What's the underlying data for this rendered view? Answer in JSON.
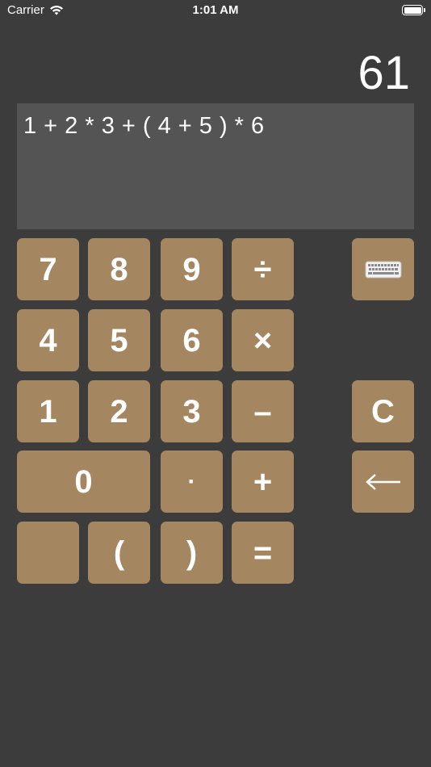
{
  "status_bar": {
    "carrier": "Carrier",
    "time": "1:01 AM"
  },
  "display": {
    "result": "61",
    "expression": "1 + 2 * 3 + ( 4 + 5 ) * 6"
  },
  "keys": {
    "seven": "7",
    "eight": "8",
    "nine": "9",
    "divide": "÷",
    "four": "4",
    "five": "5",
    "six": "6",
    "multiply": "×",
    "one": "1",
    "two": "2",
    "three": "3",
    "minus": "–",
    "clear": "C",
    "zero": "0",
    "dot": "·",
    "plus": "+",
    "blank": "",
    "open_paren": "(",
    "close_paren": ")",
    "equals": "="
  },
  "icons": {
    "keyboard": "keyboard-icon",
    "backspace": "backspace-arrow-icon",
    "wifi": "wifi-icon",
    "battery": "battery-icon"
  },
  "colors": {
    "background": "#3c3c3c",
    "expression_background": "#545454",
    "key": "#a48660",
    "text": "#ffffff"
  }
}
